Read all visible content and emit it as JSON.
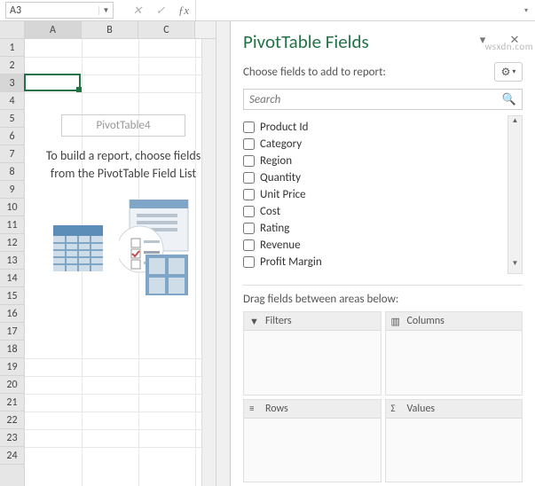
{
  "namebox": {
    "cell_ref": "A3"
  },
  "columns": [
    "A",
    "B",
    "C"
  ],
  "rows": [
    1,
    2,
    3,
    4,
    5,
    6,
    7,
    8,
    9,
    10,
    11,
    12,
    13,
    14,
    15,
    16,
    17,
    18,
    19,
    20,
    21,
    22,
    23,
    24
  ],
  "pivot_placeholder": {
    "name": "PivotTable4",
    "message": "To build a report, choose fields from the PivotTable Field List"
  },
  "fields_pane": {
    "title": "PivotTable Fields",
    "choose_label": "Choose fields to add to report:",
    "search_placeholder": "Search",
    "fields": [
      "Product Id",
      "Category",
      "Region",
      "Quantity",
      "Unit Price",
      "Cost",
      "Rating",
      "Revenue",
      "Profit Margin"
    ],
    "drag_label": "Drag fields between areas below:",
    "areas": {
      "filters": "Filters",
      "columns": "Columns",
      "rows": "Rows",
      "values": "Values"
    }
  },
  "watermark": "wsxdn.com"
}
